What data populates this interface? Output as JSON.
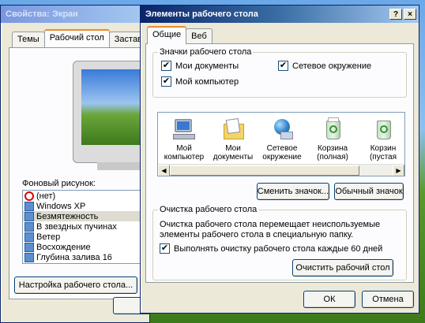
{
  "back_window": {
    "title": "Свойства: Экран",
    "tabs": [
      "Темы",
      "Рабочий стол",
      "Заставка"
    ],
    "background_label": "Фоновый рисунок:",
    "wallpapers": [
      "(нет)",
      "Windows XP",
      "Безмятежность",
      "В звездных пучинах",
      "Ветер",
      "Восхождение",
      "Глубина залива 16"
    ],
    "selected_wallpaper": "Безмятежность",
    "customize_button": "Настройка рабочего стола..."
  },
  "dialog": {
    "title": "Элементы рабочего стола",
    "help_symbol": "?",
    "close_symbol": "×",
    "tabs": [
      "Общие",
      "Веб"
    ],
    "icons_group": {
      "title": "Значки рабочего стола",
      "checkboxes": [
        {
          "label": "Мои документы",
          "checked": true
        },
        {
          "label": "Сетевое окружение",
          "checked": true
        },
        {
          "label": "Мой компьютер",
          "checked": true
        }
      ],
      "check_mark": "✔"
    },
    "icons": [
      {
        "line1": "Мой",
        "line2": "компьютер",
        "icon": "my-computer-icon"
      },
      {
        "line1": "Мои",
        "line2": "документы",
        "icon": "my-documents-icon"
      },
      {
        "line1": "Сетевое",
        "line2": "окружение",
        "icon": "network-icon"
      },
      {
        "line1": "Корзина",
        "line2": "(полная)",
        "icon": "recycle-bin-full-icon"
      },
      {
        "line1": "Корзин",
        "line2": "(пустая",
        "icon": "recycle-bin-empty-icon"
      }
    ],
    "change_icon_button": "Сменить значок...",
    "default_icon_button": "Обычный значок",
    "cleanup_group": {
      "title": "Очистка рабочего стола",
      "description": "Очистка рабочего стола перемещает неиспользуемые элементы рабочего стола в специальную папку.",
      "checkbox_label": "Выполнять очистку рабочего стола каждые 60 дней",
      "checkbox_checked": true,
      "cleanup_button": "Очистить рабочий стол"
    },
    "ok_button": "ОК",
    "cancel_button": "Отмена"
  }
}
